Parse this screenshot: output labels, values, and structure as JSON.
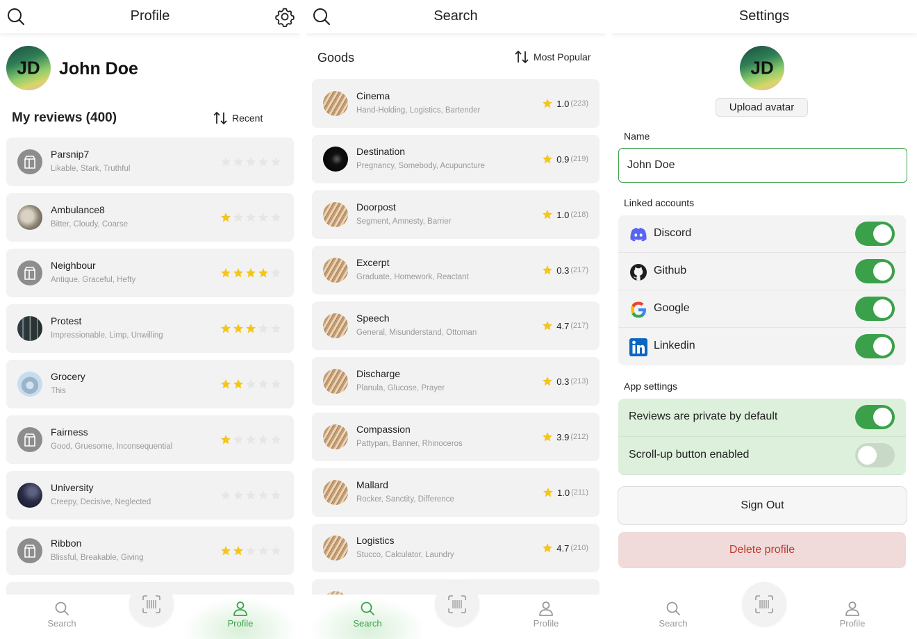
{
  "profile_panel": {
    "title": "Profile",
    "avatar_initials": "JD",
    "user_name": "John Doe",
    "reviews_heading": "My reviews (400)",
    "sort_label": "Recent",
    "reviews": [
      {
        "name": "Parsnip7",
        "tags": "Likable, Stark, Truthful",
        "stars": 0,
        "thumb": "placeholder"
      },
      {
        "name": "Ambulance8",
        "tags": "Bitter, Cloudy, Coarse",
        "stars": 1,
        "thumb": "photo-rock"
      },
      {
        "name": "Neighbour",
        "tags": "Antique, Graceful, Hefty",
        "stars": 4,
        "thumb": "placeholder"
      },
      {
        "name": "Protest",
        "tags": "Impressionable, Limp, Unwilling",
        "stars": 3,
        "thumb": "photo-forest"
      },
      {
        "name": "Grocery",
        "tags": "This",
        "stars": 2,
        "thumb": "photo-cat"
      },
      {
        "name": "Fairness",
        "tags": "Good, Gruesome, Inconsequential",
        "stars": 1,
        "thumb": "placeholder"
      },
      {
        "name": "University",
        "tags": "Creepy, Decisive, Neglected",
        "stars": 0,
        "thumb": "photo-night"
      },
      {
        "name": "Ribbon",
        "tags": "Blissful, Breakable, Giving",
        "stars": 2,
        "thumb": "placeholder"
      }
    ]
  },
  "search_panel": {
    "title": "Search",
    "section_label": "Goods",
    "sort_label": "Most Popular",
    "goods": [
      {
        "name": "Cinema",
        "tags": "Hand-Holding, Logistics, Bartender",
        "rating": "1.0",
        "count": "(223)",
        "thumb": "photo-wood"
      },
      {
        "name": "Destination",
        "tags": "Pregnancy, Somebody, Acupuncture",
        "rating": "0.9",
        "count": "(219)",
        "thumb": "photo-dark"
      },
      {
        "name": "Doorpost",
        "tags": "Segment, Amnesty, Barrier",
        "rating": "1.0",
        "count": "(218)",
        "thumb": "photo-wood"
      },
      {
        "name": "Excerpt",
        "tags": "Graduate, Homework, Reactant",
        "rating": "0.3",
        "count": "(217)",
        "thumb": "photo-wood"
      },
      {
        "name": "Speech",
        "tags": "General, Misunderstand, Ottoman",
        "rating": "4.7",
        "count": "(217)",
        "thumb": "photo-wood"
      },
      {
        "name": "Discharge",
        "tags": "Planula, Glucose, Prayer",
        "rating": "0.3",
        "count": "(213)",
        "thumb": "photo-wood"
      },
      {
        "name": "Compassion",
        "tags": "Pattypan, Banner, Rhinoceros",
        "rating": "3.9",
        "count": "(212)",
        "thumb": "photo-wood"
      },
      {
        "name": "Mallard",
        "tags": "Rocker, Sanctity, Difference",
        "rating": "1.0",
        "count": "(211)",
        "thumb": "photo-wood"
      },
      {
        "name": "Logistics",
        "tags": "Stucco, Calculator, Laundry",
        "rating": "4.7",
        "count": "(210)",
        "thumb": "photo-wood"
      }
    ]
  },
  "settings_panel": {
    "title": "Settings",
    "avatar_initials": "JD",
    "upload_label": "Upload avatar",
    "name_label": "Name",
    "name_value": "John Doe",
    "linked_label": "Linked accounts",
    "accounts": [
      {
        "name": "Discord",
        "icon": "discord-icon",
        "enabled": true
      },
      {
        "name": "Github",
        "icon": "github-icon",
        "enabled": true
      },
      {
        "name": "Google",
        "icon": "google-icon",
        "enabled": true
      },
      {
        "name": "Linkedin",
        "icon": "linkedin-icon",
        "enabled": true
      }
    ],
    "app_settings_label": "App settings",
    "app_settings": [
      {
        "name": "Reviews are private by default",
        "enabled": true
      },
      {
        "name": "Scroll-up button enabled",
        "enabled": false
      }
    ],
    "sign_out_label": "Sign Out",
    "delete_label": "Delete profile"
  },
  "nav": {
    "search_label": "Search",
    "profile_label": "Profile"
  },
  "colors": {
    "accent": "#3aa14a",
    "star": "#f5c518",
    "star_empty": "#e6e6e6",
    "danger_bg": "#f0dada",
    "danger_text": "#c0392b"
  }
}
